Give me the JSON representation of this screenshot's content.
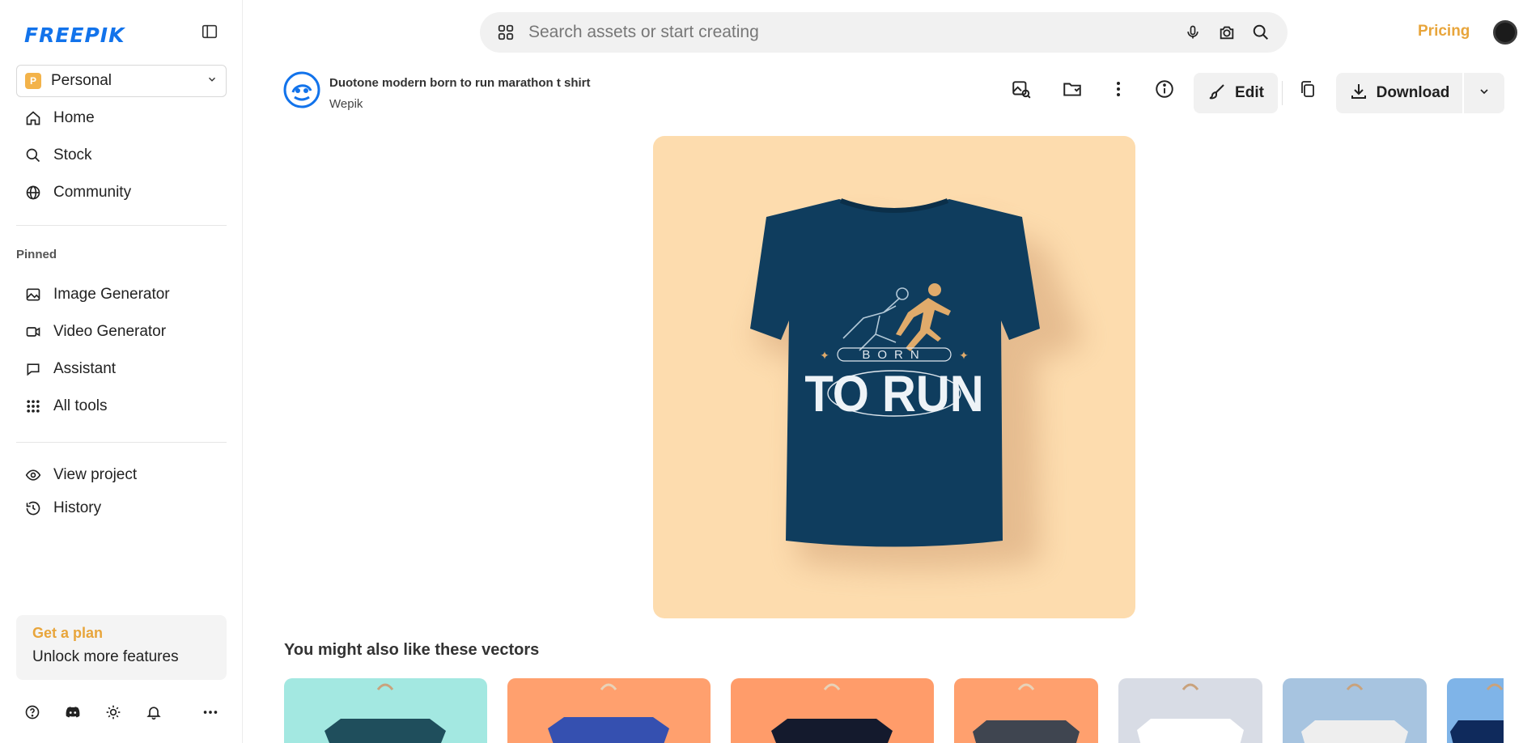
{
  "brand": {
    "logo": "FREEPIK",
    "accent": "#1273eb",
    "highlight": "#e8a53b"
  },
  "sidebar": {
    "account": {
      "badge": "P",
      "label": "Personal"
    },
    "nav": [
      {
        "label": "Home",
        "icon": "home-icon"
      },
      {
        "label": "Stock",
        "icon": "search-icon"
      },
      {
        "label": "Community",
        "icon": "globe-icon"
      }
    ],
    "pinned_label": "Pinned",
    "pinned": [
      {
        "label": "Image Generator",
        "icon": "image-icon"
      },
      {
        "label": "Video Generator",
        "icon": "video-icon"
      },
      {
        "label": "Assistant",
        "icon": "chat-icon"
      },
      {
        "label": "All tools",
        "icon": "grid-icon"
      }
    ],
    "extra": [
      {
        "label": "View project",
        "icon": "eye-icon"
      },
      {
        "label": "History",
        "icon": "history-icon"
      }
    ],
    "plan": {
      "title": "Get a plan",
      "subtitle": "Unlock more features"
    },
    "bottom_icons": [
      "help-icon",
      "discord-icon",
      "sun-icon",
      "bell-icon",
      "more-icon"
    ]
  },
  "search": {
    "placeholder": "Search assets or start creating"
  },
  "header": {
    "pricing": "Pricing"
  },
  "asset": {
    "title": "Duotone modern born to run marathon t shirt",
    "author": "Wepik",
    "edit_label": "Edit",
    "download_label": "Download",
    "preview": {
      "background": "#fddcae",
      "shirt_color": "#0f3d5e",
      "print_top": "BORN",
      "print_main": "TO RUN"
    }
  },
  "related": {
    "title": "You might also like these vectors",
    "items": [
      {
        "bg": "#a3e8e1",
        "shirt": "#1f4e5c"
      },
      {
        "bg": "#ffa06e",
        "shirt": "#3550b0"
      },
      {
        "bg": "#ff9c6a",
        "shirt": "#141a2d"
      },
      {
        "bg": "#ffa06e",
        "shirt": "#3f4550"
      },
      {
        "bg": "#d8dce5",
        "shirt": "#ffffff"
      },
      {
        "bg": "#a7c4e0",
        "shirt": "#eeeeee"
      },
      {
        "bg": "#7fb4e8",
        "shirt": "#0f2a5c"
      }
    ]
  }
}
